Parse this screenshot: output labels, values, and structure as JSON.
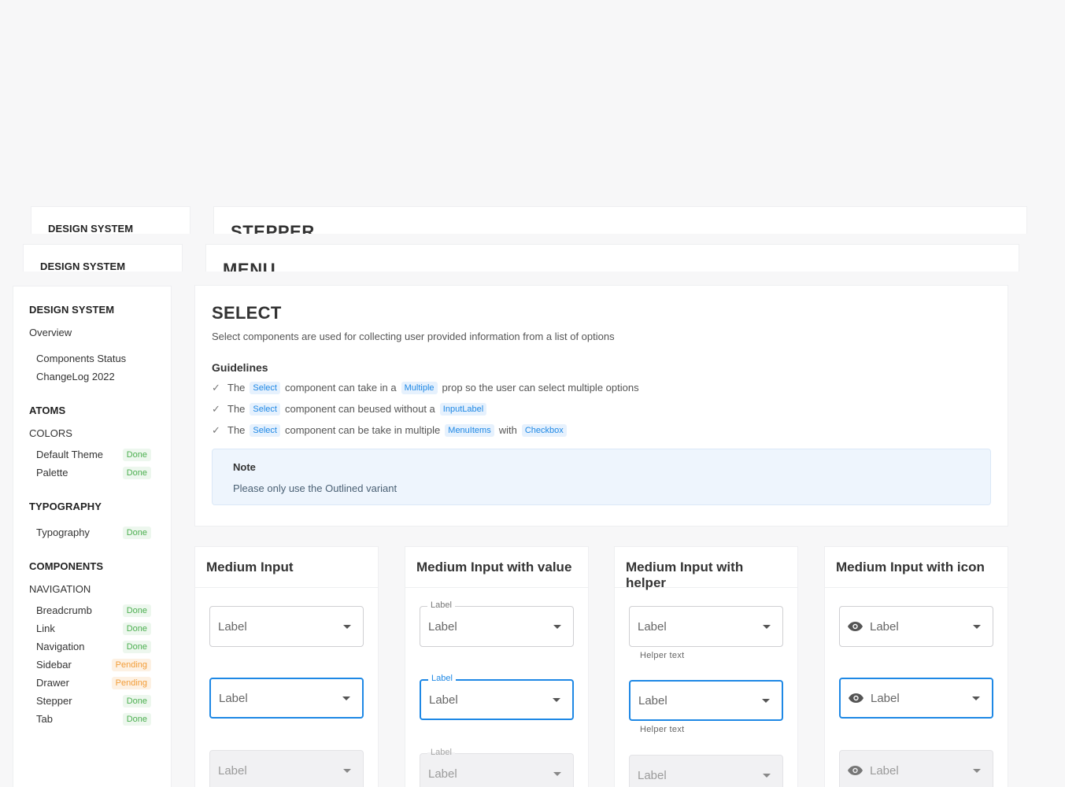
{
  "background_layers": [
    {
      "side_label": "DESIGN SYSTEM",
      "main_label": "STEPPER"
    },
    {
      "side_label": "DESIGN SYSTEM",
      "main_label": "MENU"
    }
  ],
  "sidebar": {
    "heading": "DESIGN SYSTEM",
    "overview": "Overview",
    "overview_items": [
      "Components Status",
      "ChangeLog 2022"
    ],
    "atoms": "ATOMS",
    "colors": "COLORS",
    "colors_items": [
      {
        "label": "Default Theme",
        "status": "Done"
      },
      {
        "label": "Palette",
        "status": "Done"
      }
    ],
    "typography": "TYPOGRAPHY",
    "typography_items": [
      {
        "label": "Typography",
        "status": "Done"
      }
    ],
    "components": "COMPONENTS",
    "navigation": "NAVIGATION",
    "navigation_items": [
      {
        "label": "Breadcrumb",
        "status": "Done"
      },
      {
        "label": "Link",
        "status": "Done"
      },
      {
        "label": "Navigation",
        "status": "Done"
      },
      {
        "label": "Sidebar",
        "status": "Pending"
      },
      {
        "label": "Drawer",
        "status": "Pending"
      },
      {
        "label": "Stepper",
        "status": "Done"
      },
      {
        "label": "Tab",
        "status": "Done"
      }
    ]
  },
  "main": {
    "title": "SELECT",
    "description": "Select components are used for collecting user provided information from a list of options",
    "guidelines_title": "Guidelines",
    "guidelines": [
      {
        "t1": "The",
        "c1": "Select",
        "t2": "component can take in a",
        "c2": "Multiple",
        "t3": "prop so the user can select multiple options"
      },
      {
        "t1": "The",
        "c1": "Select",
        "t2": "component can beused without a",
        "c2": "InputLabel",
        "t3": ""
      },
      {
        "t1": "The",
        "c1": "Select",
        "t2": "component can be take in multiple",
        "c2": "MenuItems",
        "t3": "with",
        "c3": "Checkbox"
      }
    ],
    "note_title": "Note",
    "note_body": "Please only use the Outlined variant"
  },
  "demos": [
    {
      "title": "Medium Input",
      "label": "Label"
    },
    {
      "title": "Medium Input with value",
      "label": "Label",
      "floating": "Label"
    },
    {
      "title": "Medium Input with helper",
      "label": "Label",
      "helper": "Helper text"
    },
    {
      "title": "Medium Input with icon",
      "label": "Label",
      "icon": "eye-icon"
    }
  ],
  "colors": {
    "accent": "#1e88e5",
    "done": "#4caf50",
    "pending": "#f29d38"
  }
}
